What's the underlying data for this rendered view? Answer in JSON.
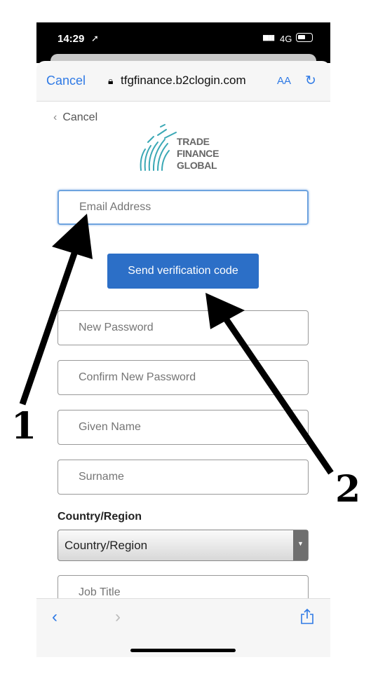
{
  "status_bar": {
    "time": "14:29",
    "network": "4G"
  },
  "browser": {
    "cancel": "Cancel",
    "url": "tfgfinance.b2clogin.com",
    "text_size": "AA"
  },
  "page": {
    "back_label": "Cancel",
    "logo_lines": [
      "TRADE",
      "FINANCE",
      "GLOBAL"
    ],
    "email_placeholder": "Email Address",
    "send_button": "Send verification code",
    "new_password_placeholder": "New Password",
    "confirm_password_placeholder": "Confirm New Password",
    "given_name_placeholder": "Given Name",
    "surname_placeholder": "Surname",
    "country_label": "Country/Region",
    "country_selected": "Country/Region",
    "job_title_placeholder": "Job Title"
  },
  "annotations": {
    "arrow1": "1",
    "arrow2": "2"
  },
  "colors": {
    "accent": "#2f7ae5",
    "button": "#2c6fc7",
    "logo": "#3aa8b5"
  }
}
